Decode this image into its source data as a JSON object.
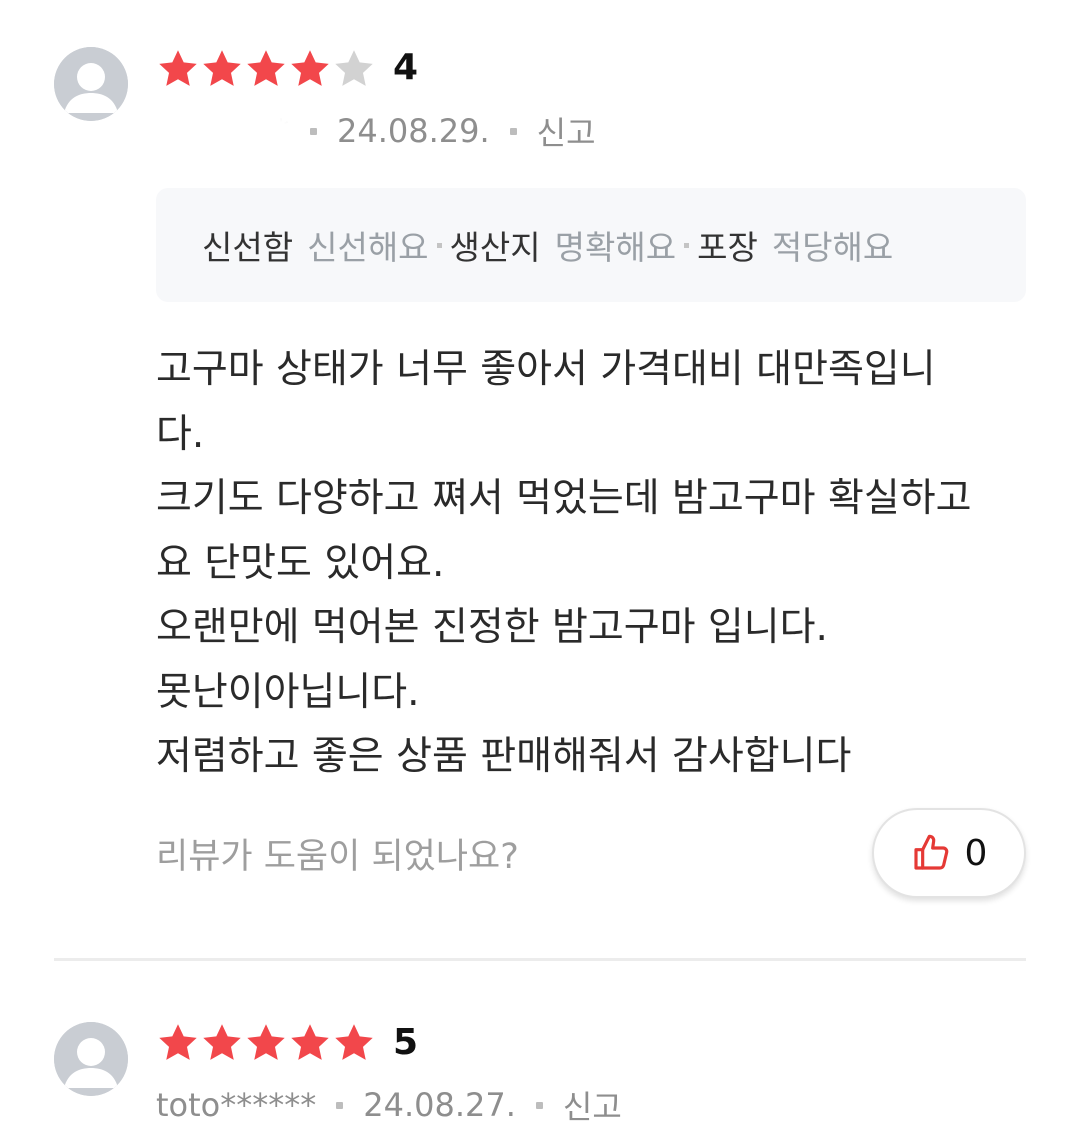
{
  "colors": {
    "star_filled": "#f2474b",
    "star_empty": "#d2d2d2",
    "thumb_icon": "#e53935",
    "avatar_bg": "#c9cdd3"
  },
  "reviews": [
    {
      "rating": 4,
      "rating_label": "4",
      "author": "**",
      "date": "24.08.29.",
      "report_label": "신고",
      "avatar_icon": "user-silhouette-icon",
      "tags": [
        {
          "key": "신선함",
          "value": "신선해요"
        },
        {
          "key": "생산지",
          "value": "명확해요"
        },
        {
          "key": "포장",
          "value": "적당해요"
        }
      ],
      "body_lines": [
        "고구마 상태가 너무 좋아서 가격대비 대만족입니",
        "다.",
        "크기도 다양하고 쪄서 먹었는데 밤고구마 확실하고",
        "요 단맛도 있어요.",
        "오랜만에 먹어본 진정한 밤고구마 입니다.",
        "못난이아닙니다.",
        "저렴하고 좋은 상품 판매해줘서 감사합니다"
      ],
      "helpful_question": "리뷰가 도움이 되었나요?",
      "like_icon": "thumbs-up-icon",
      "like_count": "0"
    },
    {
      "rating": 5,
      "rating_label": "5",
      "author": "toto******",
      "date": "24.08.27.",
      "report_label": "신고",
      "avatar_icon": "user-silhouette-icon"
    }
  ]
}
